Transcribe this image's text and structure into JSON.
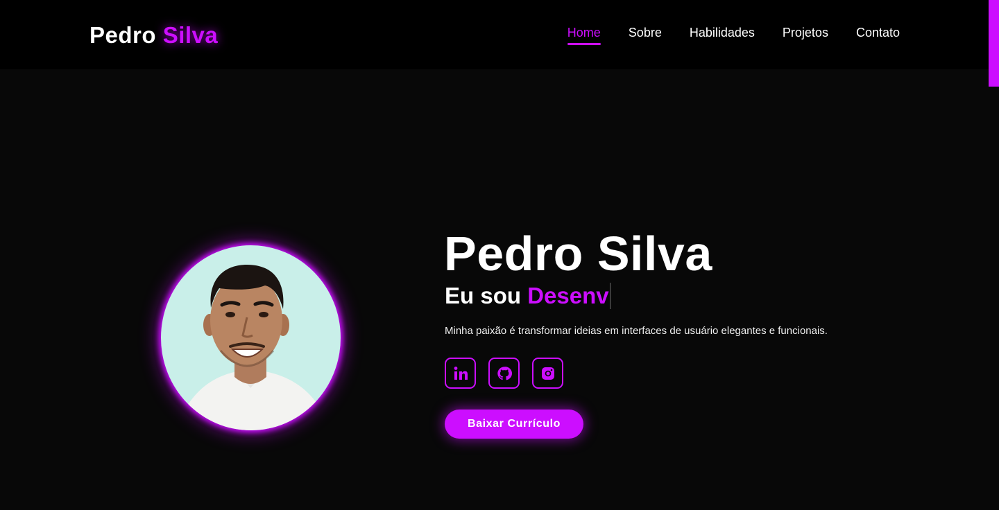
{
  "header": {
    "logo_first": "Pedro",
    "logo_accent": "Silva",
    "nav": [
      {
        "label": "Home",
        "active": true
      },
      {
        "label": "Sobre",
        "active": false
      },
      {
        "label": "Habilidades",
        "active": false
      },
      {
        "label": "Projetos",
        "active": false
      },
      {
        "label": "Contato",
        "active": false
      }
    ]
  },
  "hero": {
    "title": "Pedro Silva",
    "subtitle_prefix": "Eu sou ",
    "subtitle_typed": "Desenv",
    "description": "Minha paixão é transformar ideias em interfaces de usuário elegantes e funcionais.",
    "socials": [
      {
        "icon": "linkedin-icon"
      },
      {
        "icon": "github-icon"
      },
      {
        "icon": "instagram-icon"
      }
    ],
    "cta_label": "Baixar Currículo"
  },
  "colors": {
    "accent": "#cc0eff",
    "background": "#080808",
    "header_background": "#000000",
    "avatar_background": "#c9efe9"
  }
}
